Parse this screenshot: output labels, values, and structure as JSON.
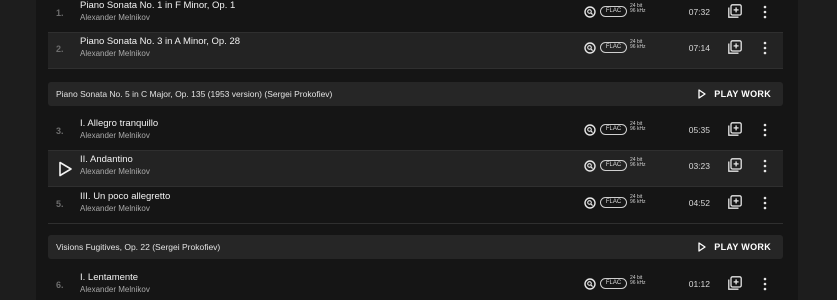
{
  "sections": [
    {
      "tracks": [
        {
          "number": "1.",
          "title": "Piano Sonata No. 1 in F Minor, Op. 1",
          "artist": "Alexander Melnikov",
          "format": "FLAC",
          "bit_depth": "24 bit",
          "sample_rate": "96 kHz",
          "duration": "07:32"
        },
        {
          "number": "2.",
          "title": "Piano Sonata No. 3 in A Minor, Op. 28",
          "artist": "Alexander Melnikov",
          "format": "FLAC",
          "bit_depth": "24 bit",
          "sample_rate": "96 kHz",
          "duration": "07:14"
        }
      ]
    },
    {
      "work_title": "Piano Sonata No. 5 in C Major, Op. 135 (1953 version) (Sergei Prokofiev)",
      "play_work_label": "PLAY WORK",
      "tracks": [
        {
          "number": "3.",
          "title": "I. Allegro tranquillo",
          "artist": "Alexander Melnikov",
          "format": "FLAC",
          "bit_depth": "24 bit",
          "sample_rate": "96 kHz",
          "duration": "05:35"
        },
        {
          "number": "",
          "title": "II. Andantino",
          "artist": "Alexander Melnikov",
          "format": "FLAC",
          "bit_depth": "24 bit",
          "sample_rate": "96 kHz",
          "duration": "03:23"
        },
        {
          "number": "5.",
          "title": "III. Un poco allegretto",
          "artist": "Alexander Melnikov",
          "format": "FLAC",
          "bit_depth": "24 bit",
          "sample_rate": "96 kHz",
          "duration": "04:52"
        }
      ]
    },
    {
      "work_title": "Visions Fugitives, Op. 22 (Sergei Prokofiev)",
      "play_work_label": "PLAY WORK",
      "tracks": [
        {
          "number": "6.",
          "title": "I. Lentamente",
          "artist": "Alexander Melnikov",
          "format": "FLAC",
          "bit_depth": "24 bit",
          "sample_rate": "96 kHz",
          "duration": "01:12"
        }
      ]
    }
  ],
  "icons": {
    "quality": "hi-res-quality-icon",
    "add": "add-to-playlist-icon",
    "more": "more-options-icon",
    "play": "play-icon"
  },
  "colors": {
    "background": "#151515",
    "row_alt": "#232323",
    "work_header": "#262626",
    "text": "#f1f1f1",
    "subtext": "#a9a9a9"
  }
}
